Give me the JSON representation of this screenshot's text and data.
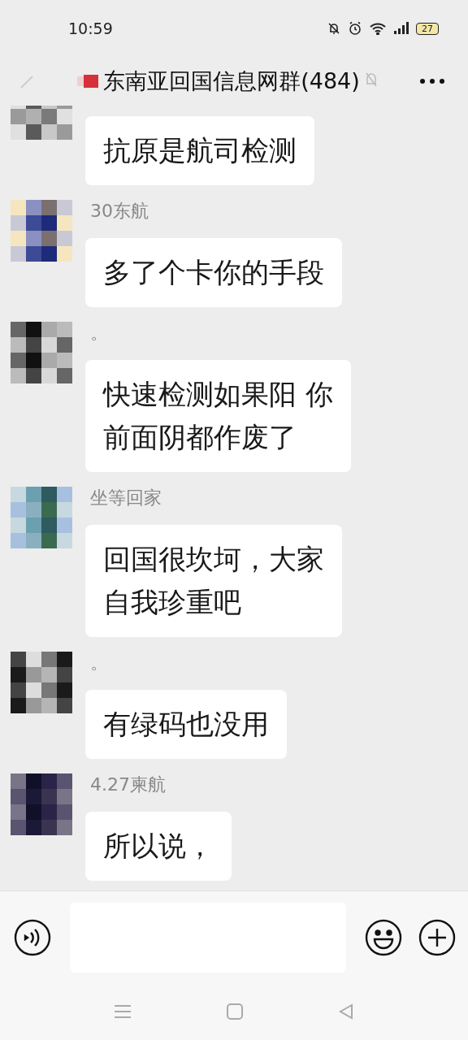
{
  "status_bar": {
    "time": "10:59",
    "battery": "27"
  },
  "header": {
    "title": "东南亚回国信息网群(484)",
    "muted": true
  },
  "messages": [
    {
      "lines": [
        "抗原是航司检测"
      ]
    },
    {
      "sender": "30东航",
      "lines": [
        "多了个卡你的手段"
      ]
    },
    {
      "sender": "。",
      "lines": [
        "快速检测如果阳 你",
        "前面阴都作废了"
      ]
    },
    {
      "sender": "坐等回家",
      "lines": [
        "回国很坎坷，大家",
        "自我珍重吧"
      ]
    },
    {
      "sender": "。",
      "lines": [
        "有绿码也没用"
      ]
    },
    {
      "sender": "4.27柬航",
      "lines": [
        "所以说，"
      ]
    }
  ]
}
